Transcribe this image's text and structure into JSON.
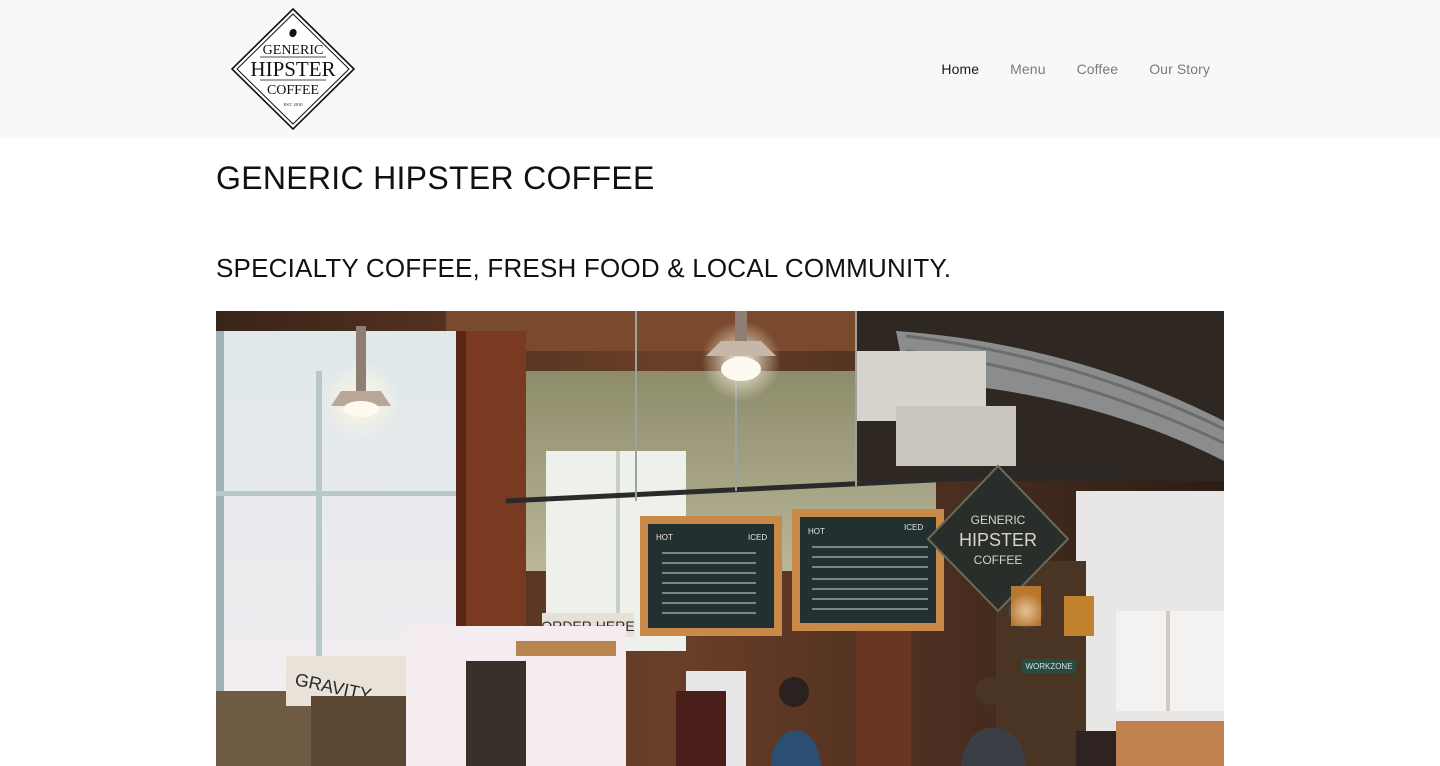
{
  "logo": {
    "line1": "GENERIC",
    "line2": "HIPSTER",
    "line3": "COFFEE",
    "est": "EST. 2010"
  },
  "nav": {
    "items": [
      {
        "label": "Home",
        "active": true
      },
      {
        "label": "Menu",
        "active": false
      },
      {
        "label": "Coffee",
        "active": false
      },
      {
        "label": "Our Story",
        "active": false
      }
    ]
  },
  "main": {
    "title": "GENERIC HIPSTER COFFEE",
    "tagline": "SPECIALTY COFFEE, FRESH FOOD & LOCAL COMMUNITY."
  },
  "hero": {
    "signs": {
      "order_here": "ORDER HERE",
      "gravity": "GRAVITY",
      "board_left_hot": "HOT",
      "board_left_iced": "ICED",
      "board_right_hot": "HOT",
      "board_right_iced": "ICED",
      "diamond_line1": "GENERIC",
      "diamond_line2": "HIPSTER",
      "diamond_line3": "COFFEE",
      "workzone": "WORKZONE"
    }
  }
}
